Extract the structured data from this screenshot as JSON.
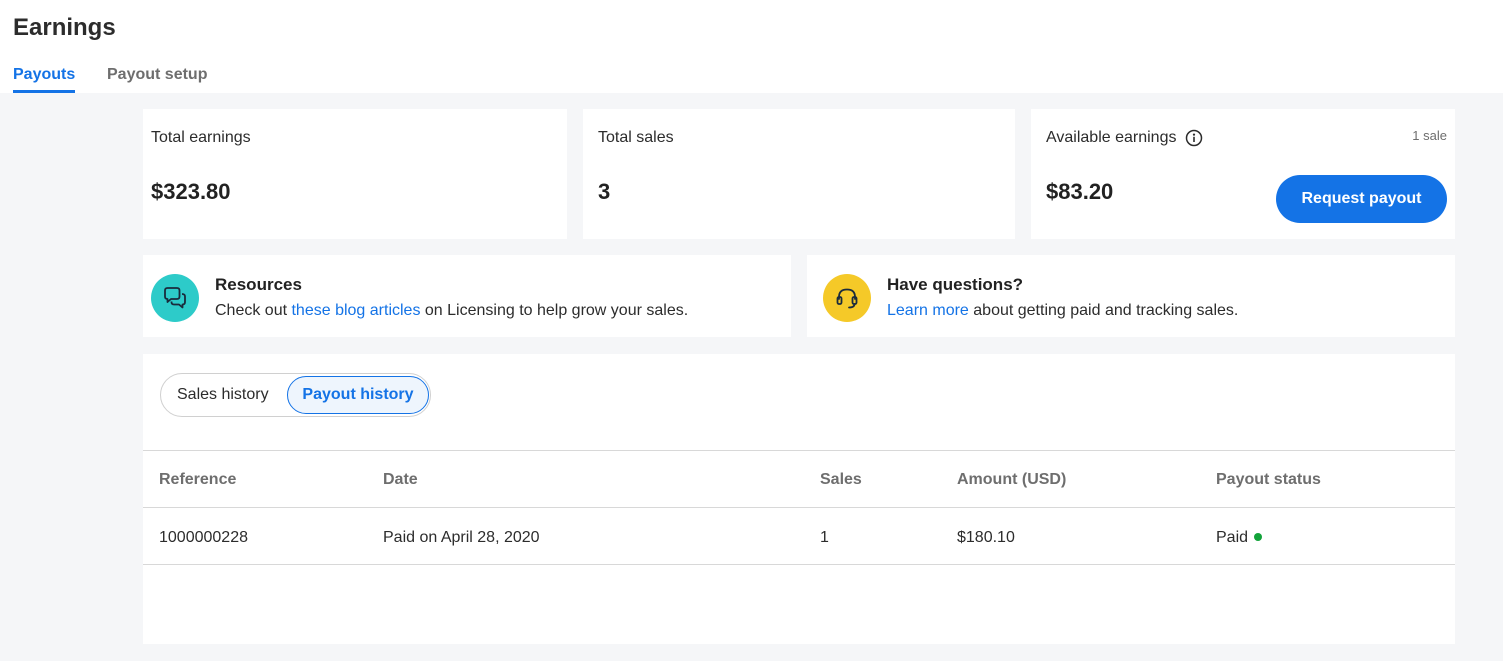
{
  "page": {
    "title": "Earnings"
  },
  "tabs": [
    {
      "label": "Payouts",
      "active": true
    },
    {
      "label": "Payout setup",
      "active": false
    }
  ],
  "stats": {
    "total_earnings": {
      "label": "Total earnings",
      "value": "$323.80"
    },
    "total_sales": {
      "label": "Total sales",
      "value": "3"
    },
    "available_earnings": {
      "label": "Available earnings",
      "value": "$83.20",
      "sale_count": "1 sale",
      "button_label": "Request payout"
    }
  },
  "resources": {
    "title": "Resources",
    "text_before": "Check out ",
    "link": "these blog articles",
    "text_after": " on Licensing to help grow your sales.",
    "icon": "chat-bubbles-icon"
  },
  "questions": {
    "title": "Have questions?",
    "link": "Learn more",
    "text_after": " about getting paid and tracking sales.",
    "icon": "headset-icon"
  },
  "history": {
    "segments": [
      {
        "label": "Sales history",
        "active": false
      },
      {
        "label": "Payout history",
        "active": true
      }
    ],
    "columns": [
      "Reference",
      "Date",
      "Sales",
      "Amount (USD)",
      "Payout status"
    ],
    "rows": [
      {
        "reference": "1000000228",
        "date": "Paid on April 28, 2020",
        "sales": "1",
        "amount": "$180.10",
        "status": "Paid"
      }
    ]
  },
  "colors": {
    "accent": "#1473e6",
    "teal": "#2dcbc9",
    "yellow": "#f5c928",
    "status_paid": "#12a33a"
  }
}
